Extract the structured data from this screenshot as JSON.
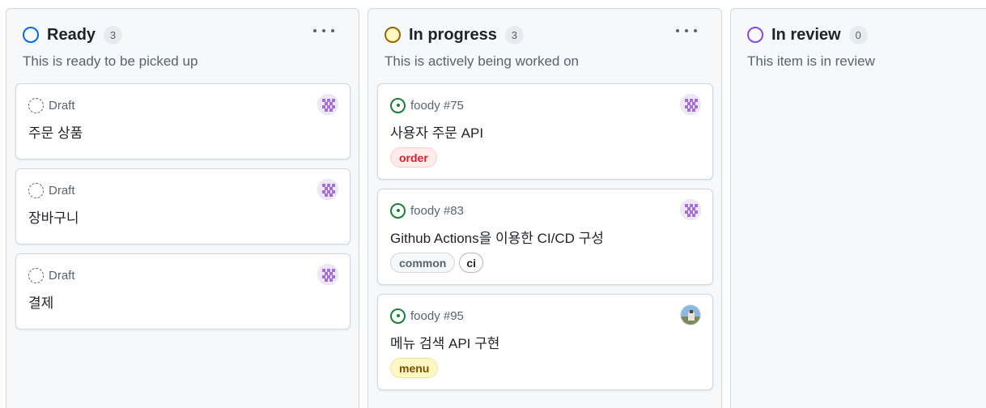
{
  "columns": [
    {
      "title": "Ready",
      "count": "3",
      "description": "This is ready to be picked up",
      "color": "#0969da",
      "cards": [
        {
          "meta": "Draft",
          "title": "주문 상품"
        },
        {
          "meta": "Draft",
          "title": "장바구니"
        },
        {
          "meta": "Draft",
          "title": "결제"
        }
      ]
    },
    {
      "title": "In progress",
      "count": "3",
      "description": "This is actively being worked on",
      "color": "#9a6700",
      "cards": [
        {
          "meta": "foody #75",
          "title": "사용자 주문 API",
          "labels": [
            "order"
          ]
        },
        {
          "meta": "foody #83",
          "title": "Github Actions을 이용한 CI/CD 구성",
          "labels": [
            "common",
            "ci"
          ]
        },
        {
          "meta": "foody #95",
          "title": "메뉴 검색 API 구현",
          "labels": [
            "menu"
          ]
        }
      ]
    },
    {
      "title": "In review",
      "count": "0",
      "description": "This item is in review",
      "color": "#8250df"
    }
  ],
  "icons": {
    "draft": "draft-issue-icon",
    "issue": "open-issue-icon",
    "more": "kebab-horizontal-icon",
    "avatar_default": "identicon-avatar",
    "avatar_photo": "photo-avatar"
  },
  "colors": {
    "identicon": "#a371d6",
    "open_issue": "#1a7f37"
  }
}
